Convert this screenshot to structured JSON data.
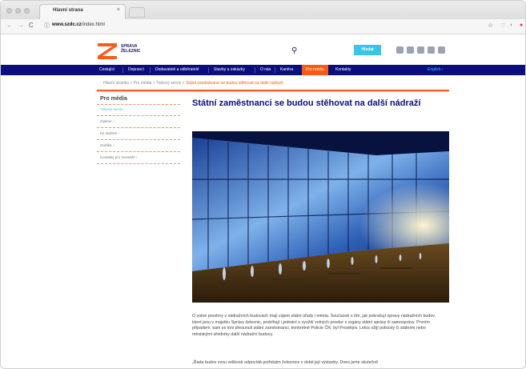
{
  "browser": {
    "tab_title": "Hlavní strana",
    "tab_close": "×",
    "url_host": "www.szdc.cz",
    "url_path": "/index.html"
  },
  "site": {
    "logo_line1": "SPRÁVA",
    "logo_line2": "ŽELEZNIC",
    "search_button": "Hledat",
    "colors": {
      "navy": "#0a0f7a",
      "orange": "#ff5a14",
      "cyan": "#35c7e8"
    },
    "social_icons": [
      "youtube-icon",
      "facebook-icon",
      "instagram-icon",
      "linkedin-icon",
      "linkedin-square-icon"
    ],
    "nav": {
      "items": [
        "Cestující",
        "Dopravci",
        "Dodavatelé a odběratelé",
        "Stavby a zakázky",
        "O nás",
        "Kariéra",
        "Pro média",
        "Kontakty"
      ],
      "english": "English ›"
    },
    "breadcrumb": {
      "path": "Hlavní stránka > Pro média > Tiskový servis > ",
      "current": "Státní zaměstnanci se budou stěhovat na další nádraží"
    },
    "sidebar": {
      "title": "Pro média",
      "items": [
        "Tiskový servis",
        "Galerie",
        "Ke stažení",
        "Grafika",
        "Kontakty pro novináře"
      ]
    },
    "article": {
      "title": "Státní zaměstnanci se budou stěhovat na další nádraží",
      "body": "O volné prostory v nádražních budovách mají zájem státní úřady i města. Současně s tím, jak pokračují opravy nádražních budov, které jsou v majetku Správy železnic, probíhají i jednání o využití volných prostor s orgány státní správy či samosprávy. Prvním případem, kam se loni přesunuli státní zaměstnanci, konkrétně Policie ČR, byl Prostějov. Letos ožijí policisty či státními nebo městskými úředníky další nádražní budovy.",
      "body2": "„Řada budov svou velikostí odpovídá potřebám železnice v době její výstavby. Dnes jsme skutečně"
    }
  }
}
